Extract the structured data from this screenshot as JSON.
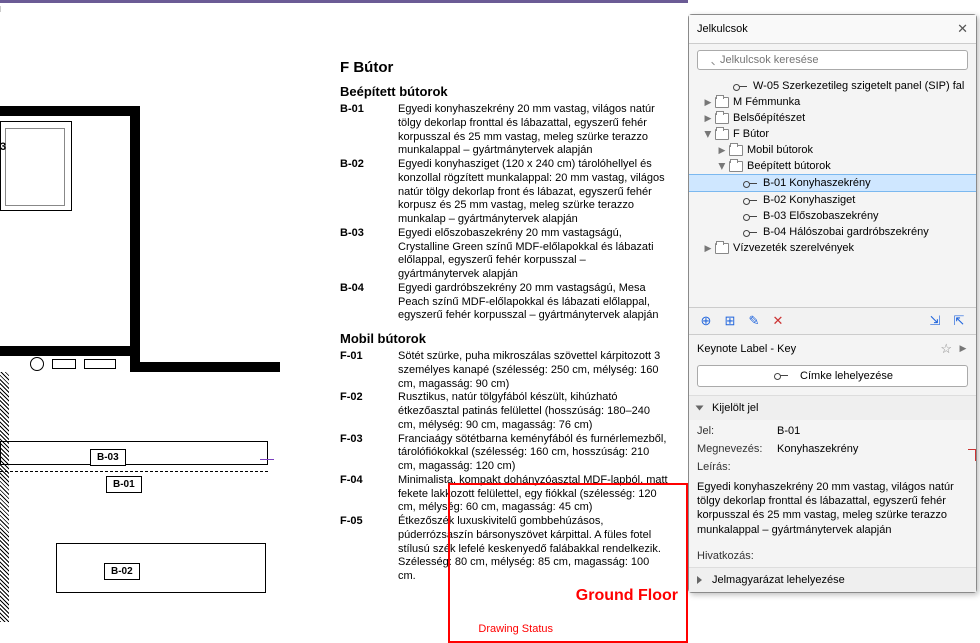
{
  "drawing": {
    "roomLabel": "3",
    "b01": "B-01",
    "b02": "B-02",
    "b03": "B-03",
    "groundFloor": "Ground Floor",
    "drawingStatus": "Drawing Status"
  },
  "legend": {
    "title": "F Bútor",
    "sec1": "Beépített bútorok",
    "sec2": "Mobil bútorok",
    "built": [
      {
        "k": "B-01",
        "v": "Egyedi konyhaszekrény 20 mm vastag, világos natúr tölgy dekorlap fronttal és lábazattal, egyszerű fehér korpusszal és 25 mm vastag, meleg szürke terazzo munkalappal – gyártmánytervek alapján"
      },
      {
        "k": "B-02",
        "v": "Egyedi konyhasziget (120 x 240 cm) tárolóhellyel és konzollal rögzített munkalappal: 20 mm vastag, világos natúr tölgy dekorlap front és lábazat, egyszerű fehér korpusz és 25 mm vastag, meleg szürke terazzo munkalap – gyártmánytervek alapján"
      },
      {
        "k": "B-03",
        "v": "Egyedi előszobaszekrény 20 mm vastagságú, Crystalline Green színű MDF-előlapokkal és lábazati előlappal, egyszerű fehér korpusszal – gyártmánytervek alapján"
      },
      {
        "k": "B-04",
        "v": "Egyedi gardróbszekrény 20 mm vastagságú, Mesa Peach színű MDF-előlapokkal és lábazati előlappal, egyszerű fehér korpusszal – gyártmánytervek alapján"
      }
    ],
    "mobile": [
      {
        "k": "F-01",
        "v": "Sötét szürke, puha mikroszálas szövettel kárpitozott 3 személyes kanapé (szélesség: 250 cm, mélység: 160 cm, magasság: 90 cm)"
      },
      {
        "k": "F-02",
        "v": "Rusztikus, natúr tölgyfából készült, kihúzható étkezőasztal patinás felülettel (hosszúság: 180–240 cm, mélység: 90 cm, magasság: 76 cm)"
      },
      {
        "k": "F-03",
        "v": "Franciaágy sötétbarna keményfából és furnérlemezből, tárolófiókokkal (szélesség: 160 cm, hosszúság: 210 cm, magasság: 120 cm)"
      },
      {
        "k": "F-04",
        "v": "Minimalista, kompakt dohányzóasztal MDF-lapból, matt fekete lakkozott felülettel, egy fiókkal (szélesség: 120 cm, mélység: 60 cm, magasság: 45 cm)"
      },
      {
        "k": "F-05",
        "v": "Étkezőszék luxuskivitelű gombbehúzásos, púderrózsaszín bársonyszövet kárpittal. A füles fotel stílusú szék lefelé keskenyedő falábakkal rendelkezik. Szélesség: 80 cm, mélység: 85 cm, magasság: 100 cm."
      }
    ]
  },
  "panel": {
    "title": "Jelkulcsok",
    "searchPlaceholder": "Jelkulcsok keresése",
    "tree": {
      "w05": "W-05 Szerkezetileg szigetelt panel (SIP) fal",
      "mFem": "M Fémmunka",
      "belso": "Belsőépítészet",
      "fButor": "F Bútor",
      "mobil": "Mobil bútorok",
      "beep": "Beépített bútorok",
      "b01": "B-01 Konyhaszekrény",
      "b02": "B-02 Konyhasziget",
      "b03": "B-03 Előszobaszekrény",
      "b04": "B-04 Hálószobai gardróbszekrény",
      "viz": "Vízvezeték szerelvények"
    },
    "keynoteLabel": "Keynote Label - Key",
    "cimkeBtn": "Címke lehelyezése",
    "kijelolt": "Kijelölt jel",
    "jelLab": "Jel:",
    "jelVal": "B-01",
    "megLab": "Megnevezés:",
    "megVal": "Konyhaszekrény",
    "leirasLab": "Leírás:",
    "leirasVal": "Egyedi konyhaszekrény 20 mm vastag, világos natúr tölgy dekorlap fronttal és lábazattal, egyszerű fehér korpusszal és 25 mm vastag, meleg szürke terazzo munkalappal – gyártmánytervek alapján",
    "hivLab": "Hivatkozás:",
    "jelmag": "Jelmagyarázat lehelyezése"
  }
}
